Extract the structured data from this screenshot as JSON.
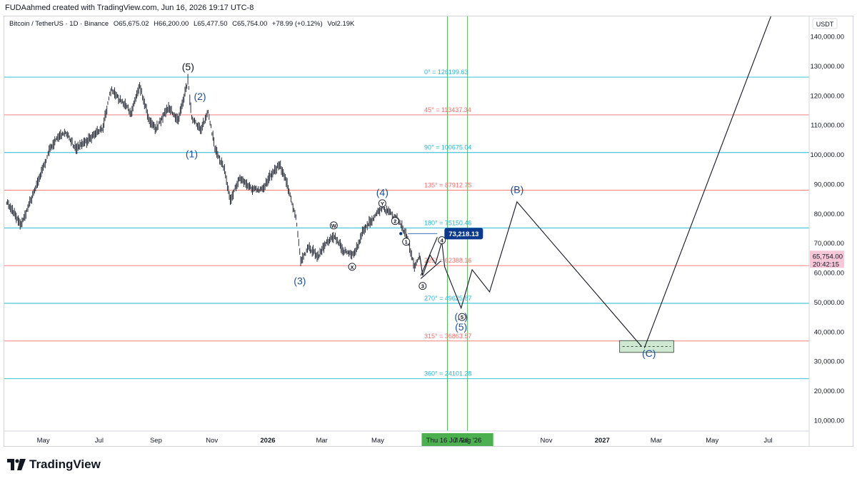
{
  "header": {
    "creator_line": "FUDAahmed created with TradingView.com, Jun 16, 2026 19:17 UTC-8"
  },
  "legend": {
    "symbol": "Bitcoin / TetherUS · 1D · Binance",
    "open": "O65,675.02",
    "high": "H66,200.00",
    "low": "L65,477.50",
    "close": "C65,754.00",
    "change": "+78.99 (+0.12%)",
    "volume": "Vol2.19K"
  },
  "footer": {
    "brand": "TradingView"
  },
  "colors": {
    "fib_cyan": "#22b7d1",
    "fib_red": "#f26d6d",
    "vertical_green": "#4caf50",
    "wave_blue": "#1f4e96",
    "price_tag": "#0b3a8c",
    "last_price_bg": "#f7c8d8",
    "candle": "#2a2e39"
  },
  "chart_data": {
    "type": "line",
    "currency_label": "USDT",
    "y_range": [
      1000,
      150000
    ],
    "y_ticks": [
      "140,000.00",
      "130,000.00",
      "120,000.00",
      "110,000.00",
      "100,000.00",
      "90,000.00",
      "80,000.00",
      "70,000.00",
      "60,000.00",
      "50,000.00",
      "40,000.00",
      "30,000.00",
      "20,000.00",
      "10,000.00"
    ],
    "y_tick_values": [
      140000,
      130000,
      120000,
      110000,
      100000,
      90000,
      80000,
      70000,
      60000,
      50000,
      40000,
      30000,
      20000,
      10000
    ],
    "x_ticks": [
      {
        "label": "May",
        "date": "2025-05-01",
        "bold": false
      },
      {
        "label": "Jul",
        "date": "2025-07-01",
        "bold": false
      },
      {
        "label": "Sep",
        "date": "2025-09-01",
        "bold": false
      },
      {
        "label": "Nov",
        "date": "2025-11-01",
        "bold": false
      },
      {
        "label": "2026",
        "date": "2026-01-01",
        "bold": true
      },
      {
        "label": "Mar",
        "date": "2026-03-01",
        "bold": false
      },
      {
        "label": "May",
        "date": "2026-05-01",
        "bold": false
      },
      {
        "label": "Nov",
        "date": "2026-11-01",
        "bold": false
      },
      {
        "label": "2027",
        "date": "2027-01-01",
        "bold": true
      },
      {
        "label": "Mar",
        "date": "2027-03-01",
        "bold": false
      },
      {
        "label": "May",
        "date": "2027-05-01",
        "bold": false
      },
      {
        "label": "Jul",
        "date": "2027-07-01",
        "bold": false
      }
    ],
    "x_markers": [
      {
        "label": "Thu 16 Jul '26",
        "date": "2026-07-16"
      },
      {
        "label": "7 Aug '26",
        "date": "2026-08-07"
      }
    ],
    "last_price": {
      "price": "65,754.00",
      "countdown": "20:42:15",
      "value": 65754
    },
    "price_tag": {
      "label": "73,218.13",
      "value": 73218.13
    },
    "fib_levels": [
      {
        "label": "0° = 126199.63",
        "value": 126199.63,
        "color": "cyan"
      },
      {
        "label": "45° = 113437.34",
        "value": 113437.34,
        "color": "red"
      },
      {
        "label": "90° = 100675.04",
        "value": 100675.04,
        "color": "cyan"
      },
      {
        "label": "135° = 87912.75",
        "value": 87912.75,
        "color": "red"
      },
      {
        "label": "180° = 75150.46",
        "value": 75150.46,
        "color": "cyan"
      },
      {
        "label": "225° = 62388.16",
        "value": 62388.16,
        "color": "red"
      },
      {
        "label": "270° = 49625.87",
        "value": 49625.87,
        "color": "cyan"
      },
      {
        "label": "315° = 36863.57",
        "value": 36863.57,
        "color": "red"
      },
      {
        "label": "360° = 24101.28",
        "value": 24101.28,
        "color": "cyan"
      }
    ],
    "price_path": [
      [
        "2025-03-22",
        84000
      ],
      [
        "2025-04-07",
        76000
      ],
      [
        "2025-04-22",
        88000
      ],
      [
        "2025-05-10",
        103000
      ],
      [
        "2025-05-25",
        108000
      ],
      [
        "2025-06-05",
        102000
      ],
      [
        "2025-06-20",
        105000
      ],
      [
        "2025-07-05",
        109000
      ],
      [
        "2025-07-14",
        122000
      ],
      [
        "2025-07-25",
        118000
      ],
      [
        "2025-08-05",
        114000
      ],
      [
        "2025-08-14",
        123500
      ],
      [
        "2025-08-25",
        111000
      ],
      [
        "2025-09-01",
        108500
      ],
      [
        "2025-09-15",
        116000
      ],
      [
        "2025-09-25",
        111000
      ],
      [
        "2025-10-06",
        125000
      ],
      [
        "2025-10-10",
        112000
      ],
      [
        "2025-10-20",
        108500
      ],
      [
        "2025-10-28",
        114000
      ],
      [
        "2025-11-05",
        101000
      ],
      [
        "2025-11-15",
        95000
      ],
      [
        "2025-11-21",
        84000
      ],
      [
        "2025-12-01",
        92000
      ],
      [
        "2025-12-15",
        88000
      ],
      [
        "2025-12-26",
        88000
      ],
      [
        "2026-01-06",
        93500
      ],
      [
        "2026-01-14",
        96500
      ],
      [
        "2026-01-22",
        90000
      ],
      [
        "2026-02-01",
        78000
      ],
      [
        "2026-02-06",
        64000
      ],
      [
        "2026-02-15",
        68500
      ],
      [
        "2026-02-25",
        65000
      ],
      [
        "2026-03-05",
        70000
      ],
      [
        "2026-03-15",
        72000
      ],
      [
        "2026-03-25",
        67000
      ],
      [
        "2026-04-05",
        66000
      ],
      [
        "2026-04-15",
        74000
      ],
      [
        "2026-04-25",
        78000
      ],
      [
        "2026-05-06",
        82000
      ],
      [
        "2026-05-15",
        80000
      ],
      [
        "2026-05-24",
        77000
      ],
      [
        "2026-06-01",
        73000
      ],
      [
        "2026-06-10",
        62000
      ],
      [
        "2026-06-16",
        65754
      ]
    ],
    "projection_path": [
      [
        "2026-06-16",
        65754
      ],
      [
        "2026-06-19",
        59000
      ],
      [
        "2026-06-27",
        66000
      ],
      [
        "2026-07-03",
        63000
      ],
      [
        "2026-07-10",
        70500
      ],
      [
        "2026-07-13",
        62000
      ],
      [
        "2026-07-31",
        48000
      ],
      [
        "2026-08-12",
        61000
      ],
      [
        "2026-08-31",
        53500
      ],
      [
        "2026-09-30",
        84000
      ],
      [
        "2027-02-13",
        35000
      ]
    ],
    "projection_path_2": [
      [
        "2027-02-16",
        34500
      ],
      [
        "2027-07-08",
        150000
      ]
    ],
    "triangle_lines": [
      [
        [
          "2026-06-17",
          59000
        ],
        [
          "2026-07-05",
          72000
        ]
      ],
      [
        [
          "2026-06-17",
          58000
        ],
        [
          "2026-07-09",
          64000
        ]
      ]
    ],
    "price_tag_line": [
      [
        "2026-06-03",
        73218.13
      ],
      [
        "2026-07-05",
        73218.13
      ]
    ],
    "target_box": {
      "x0": "2027-01-20",
      "x1": "2027-03-20",
      "y0": 33000,
      "y1": 37000,
      "mid": 35000
    },
    "wave_labels": [
      {
        "text": "(5)",
        "date": "2025-10-06",
        "value": 128500,
        "color": "black"
      },
      {
        "text": "(2)",
        "date": "2025-10-19",
        "value": 118500,
        "color": "blue"
      },
      {
        "text": "(1)",
        "date": "2025-10-10",
        "value": 99000,
        "color": "blue"
      },
      {
        "text": "(3)",
        "date": "2026-02-05",
        "value": 56000,
        "color": "blue"
      },
      {
        "text": "(4)",
        "date": "2026-05-06",
        "value": 86000,
        "color": "blue"
      },
      {
        "text": "(B)",
        "date": "2026-09-30",
        "value": 87000,
        "color": "blue"
      },
      {
        "text": "(A)",
        "date": "2026-07-31",
        "value": 44000,
        "color": "blue"
      },
      {
        "text": "(5)",
        "date": "2026-07-31",
        "value": 40500,
        "color": "blue"
      },
      {
        "text": "(C)",
        "date": "2027-02-21",
        "value": 31500,
        "color": "blue"
      }
    ],
    "circle_labels": [
      {
        "text": "W",
        "date": "2026-03-14",
        "value": 76000
      },
      {
        "text": "X",
        "date": "2026-04-03",
        "value": 62000
      },
      {
        "text": "Y",
        "date": "2026-05-06",
        "value": 83500
      },
      {
        "text": "1",
        "date": "2026-06-01",
        "value": 70500
      },
      {
        "text": "2",
        "date": "2026-05-20",
        "value": 77500
      },
      {
        "text": "3",
        "date": "2026-06-19",
        "value": 55500
      },
      {
        "text": "4",
        "date": "2026-07-10",
        "value": 71000
      },
      {
        "text": "5",
        "date": "2026-08-01",
        "value": 45000
      }
    ]
  }
}
